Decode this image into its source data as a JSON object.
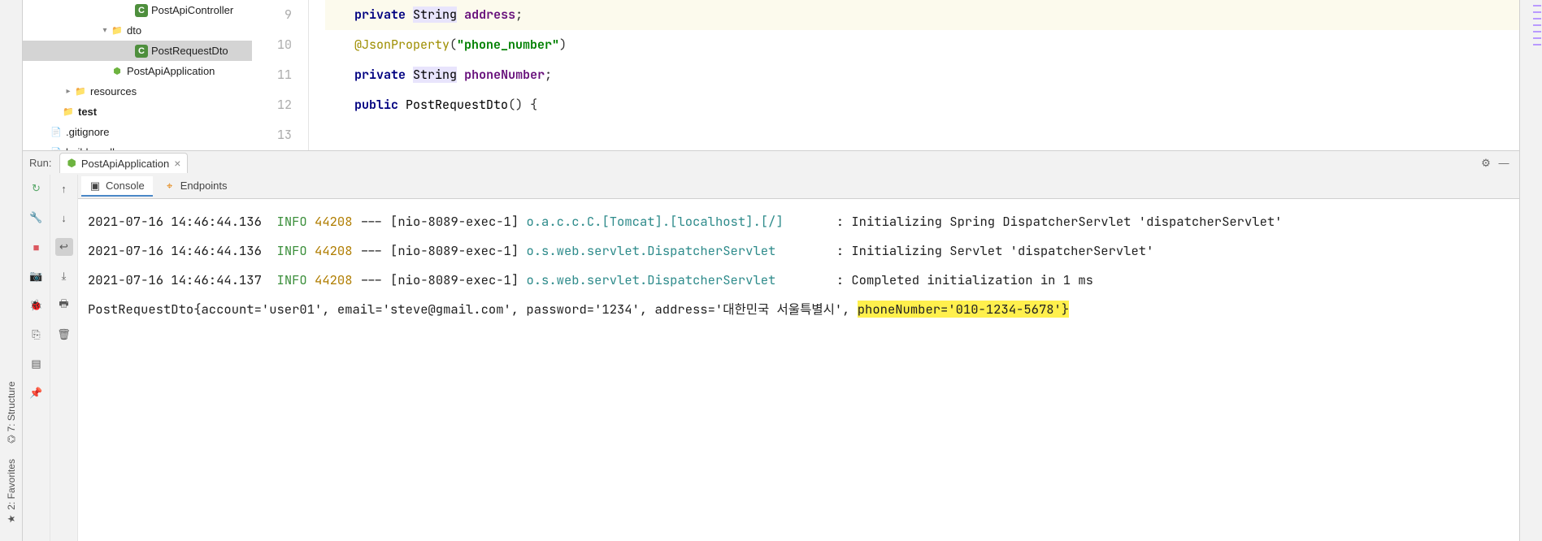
{
  "leftRail": {
    "structure": "7: Structure",
    "favorites": "2: Favorites"
  },
  "tree": {
    "items": [
      {
        "indent": 120,
        "icon": "class",
        "label": "PostApiController",
        "chevron": ""
      },
      {
        "indent": 90,
        "icon": "folder",
        "label": "dto",
        "chevron": "down"
      },
      {
        "indent": 120,
        "icon": "class",
        "label": "PostRequestDto",
        "chevron": "",
        "selected": true
      },
      {
        "indent": 90,
        "icon": "spring",
        "label": "PostApiApplication",
        "chevron": ""
      },
      {
        "indent": 45,
        "icon": "folder",
        "label": "resources",
        "chevron": "right"
      },
      {
        "indent": 30,
        "icon": "folder",
        "label": "test",
        "chevron": "",
        "bold": true
      },
      {
        "indent": 15,
        "icon": "file",
        "label": ".gitignore",
        "chevron": ""
      },
      {
        "indent": 15,
        "icon": "file",
        "label": "build.gradle",
        "chevron": ""
      }
    ]
  },
  "editor": {
    "lines": [
      {
        "num": "9",
        "cls": "hl-line",
        "html": "    <span class='kw-private'>private</span> <span class='type type-hl'>String</span> <span class='field'>address</span>;"
      },
      {
        "num": "10",
        "cls": "",
        "html": "    <span class='ann'>@JsonProperty</span>(<span class='str'>\"phone_number\"</span>)"
      },
      {
        "num": "11",
        "cls": "",
        "html": "    <span class='kw-private'>private</span> <span class='type type-hl'>String</span> <span class='field'>phoneNumber</span>;"
      },
      {
        "num": "12",
        "cls": "",
        "html": ""
      },
      {
        "num": "13",
        "cls": "",
        "html": "    <span class='kw-public'>public</span> <span class='type'>PostRequestDto</span>() {"
      }
    ]
  },
  "run": {
    "label": "Run:",
    "tab": "PostApiApplication",
    "subtabs": {
      "console": "Console",
      "endpoints": "Endpoints"
    }
  },
  "console": {
    "lines": [
      {
        "ts": "2021-07-16 14:46:44.136",
        "level": "INFO",
        "pid": "44208",
        "thread": "[nio-8089-exec-1]",
        "logger": "o.a.c.c.C.[Tomcat].[localhost].[/]",
        "msg": "Initializing Spring DispatcherServlet 'dispatcherServlet'"
      },
      {
        "ts": "2021-07-16 14:46:44.136",
        "level": "INFO",
        "pid": "44208",
        "thread": "[nio-8089-exec-1]",
        "logger": "o.s.web.servlet.DispatcherServlet",
        "msg": "Initializing Servlet 'dispatcherServlet'"
      },
      {
        "ts": "2021-07-16 14:46:44.137",
        "level": "INFO",
        "pid": "44208",
        "thread": "[nio-8089-exec-1]",
        "logger": "o.s.web.servlet.DispatcherServlet",
        "msg": "Completed initialization in 1 ms"
      }
    ],
    "objLinePrefix": "PostRequestDto{account='user01', email='steve@gmail.com', password='1234', address='대한민국 서울특별시', ",
    "objLineHighlight": "phoneNumber='010-1234-5678'}",
    "loggerPad": 40
  },
  "icons": {
    "gear": "⚙",
    "minus": "—",
    "close": "×",
    "play": "▶",
    "camera": "📷",
    "print": "🖶",
    "trash": "🗑",
    "wrap": "↩",
    "up": "↑",
    "down": "↓",
    "stop": "■",
    "rerun": "↻",
    "wrench": "🔧",
    "bug": "🐞",
    "exit": "⎘",
    "layers": "▤",
    "pin": "📌",
    "star": "★",
    "struct": "⌬"
  }
}
